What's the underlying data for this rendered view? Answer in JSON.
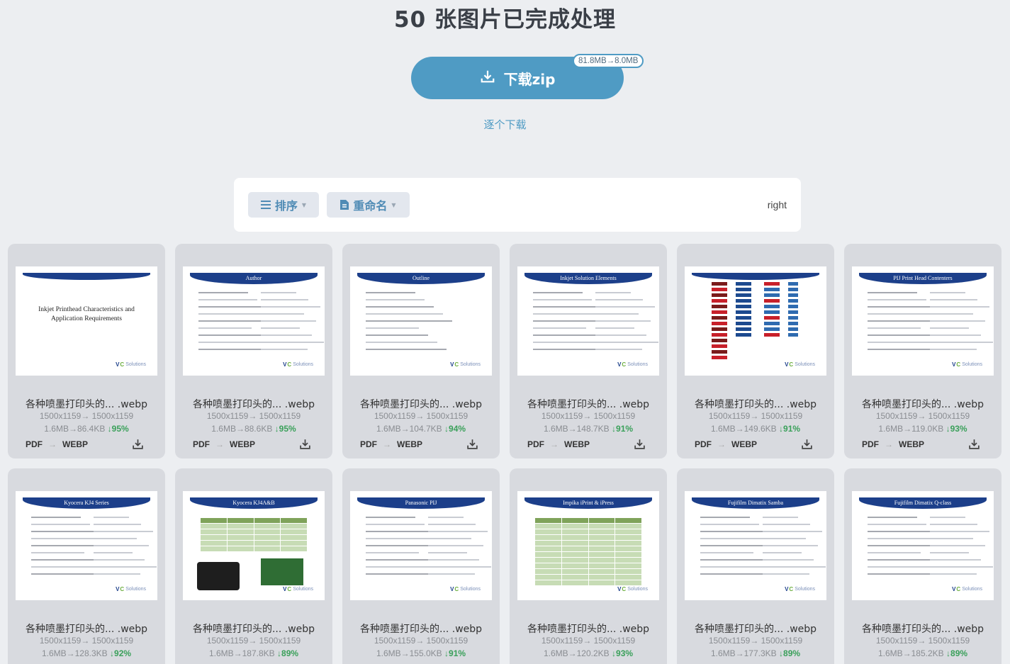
{
  "header": {
    "title": "50 张图片已完成处理",
    "zip_button": "下载zip",
    "size_badge": "81.8MB→8.0MB",
    "single_download": "逐个下载"
  },
  "toolbar": {
    "sort_label": "排序",
    "rename_label": "重命名",
    "right_text": "right"
  },
  "colors": {
    "accent": "#4f9bc4",
    "success": "#3aa05a",
    "slide_blue": "#1c3f8a"
  },
  "icons": {
    "download": "download-icon",
    "sort": "list-icon",
    "rename": "file-icon",
    "item_download": "download-icon"
  },
  "cards": [
    {
      "slide_title": "",
      "file": "各种喷墨打印头的... .webp",
      "dims": "1500x1159→ 1500x1159",
      "size": "1.6MB→86.4KB",
      "pct": "↓95%",
      "from": "PDF",
      "to": "WEBP",
      "slide_body": "Inkjet Printhead Characteristics and Application Requirements"
    },
    {
      "slide_title": "Author",
      "file": "各种喷墨打印头的... .webp",
      "dims": "1500x1159→ 1500x1159",
      "size": "1.6MB→88.6KB",
      "pct": "↓95%",
      "from": "PDF",
      "to": "WEBP"
    },
    {
      "slide_title": "Outline",
      "file": "各种喷墨打印头的... .webp",
      "dims": "1500x1159→ 1500x1159",
      "size": "1.6MB→104.7KB",
      "pct": "↓94%",
      "from": "PDF",
      "to": "WEBP"
    },
    {
      "slide_title": "Inkjet Solution Elements",
      "file": "各种喷墨打印头的... .webp",
      "dims": "1500x1159→ 1500x1159",
      "size": "1.6MB→148.7KB",
      "pct": "↓91%",
      "from": "PDF",
      "to": "WEBP"
    },
    {
      "slide_title": "",
      "file": "各种喷墨打印头的... .webp",
      "dims": "1500x1159→ 1500x1159",
      "size": "1.6MB→149.6KB",
      "pct": "↓91%",
      "from": "PDF",
      "to": "WEBP"
    },
    {
      "slide_title": "PIJ Print Head Contenters",
      "file": "各种喷墨打印头的... .webp",
      "dims": "1500x1159→ 1500x1159",
      "size": "1.6MB→119.0KB",
      "pct": "↓93%",
      "from": "PDF",
      "to": "WEBP"
    },
    {
      "slide_title": "Kyocera KJ4 Series",
      "file": "各种喷墨打印头的... .webp",
      "dims": "1500x1159→ 1500x1159",
      "size": "1.6MB→128.3KB",
      "pct": "↓92%",
      "from": "PDF",
      "to": "WEBP"
    },
    {
      "slide_title": "Kyocera KJ4A&B",
      "file": "各种喷墨打印头的... .webp",
      "dims": "1500x1159→ 1500x1159",
      "size": "1.6MB→187.8KB",
      "pct": "↓89%",
      "from": "PDF",
      "to": "WEBP"
    },
    {
      "slide_title": "Panasonic PIJ",
      "file": "各种喷墨打印头的... .webp",
      "dims": "1500x1159→ 1500x1159",
      "size": "1.6MB→155.0KB",
      "pct": "↓91%",
      "from": "PDF",
      "to": "WEBP"
    },
    {
      "slide_title": "Impika iPrint & iPress",
      "file": "各种喷墨打印头的... .webp",
      "dims": "1500x1159→ 1500x1159",
      "size": "1.6MB→120.2KB",
      "pct": "↓93%",
      "from": "PDF",
      "to": "WEBP"
    },
    {
      "slide_title": "Fujifilm Dimatix Samba",
      "file": "各种喷墨打印头的... .webp",
      "dims": "1500x1159→ 1500x1159",
      "size": "1.6MB→177.3KB",
      "pct": "↓89%",
      "from": "PDF",
      "to": "WEBP"
    },
    {
      "slide_title": "Fujifilm Dimatix Q-class",
      "file": "各种喷墨打印头的... .webp",
      "dims": "1500x1159→ 1500x1159",
      "size": "1.6MB→185.2KB",
      "pct": "↓89%",
      "from": "PDF",
      "to": "WEBP"
    }
  ],
  "logo_text": "Solutions"
}
